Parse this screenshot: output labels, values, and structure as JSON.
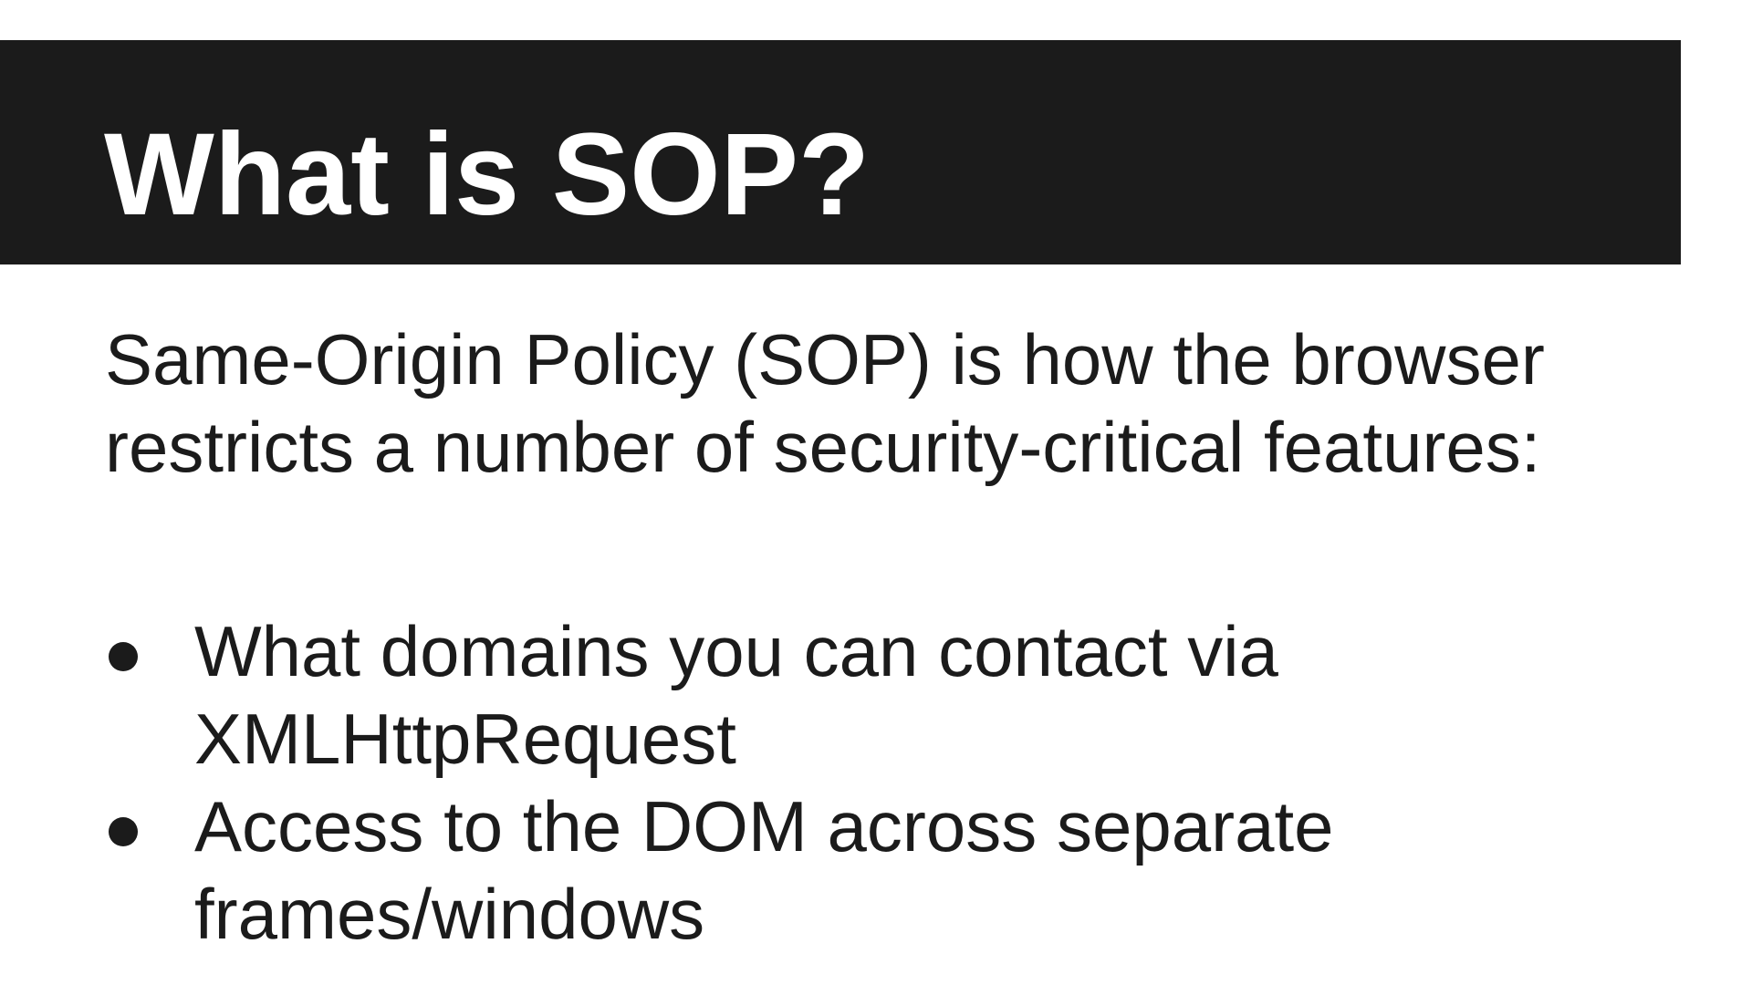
{
  "slide": {
    "title": "What is SOP?",
    "intro": "Same-Origin Policy (SOP) is how the browser restricts a number of security-critical features:",
    "bullets": [
      {
        "text": "What domains you can contact via XMLHttpRequest"
      },
      {
        "text": "Access to the DOM across separate frames/windows"
      }
    ],
    "colors": {
      "title_bar": "#1b1b1b",
      "title_text": "#ffffff",
      "body_text": "#1b1b1b",
      "background": "#ffffff"
    }
  }
}
